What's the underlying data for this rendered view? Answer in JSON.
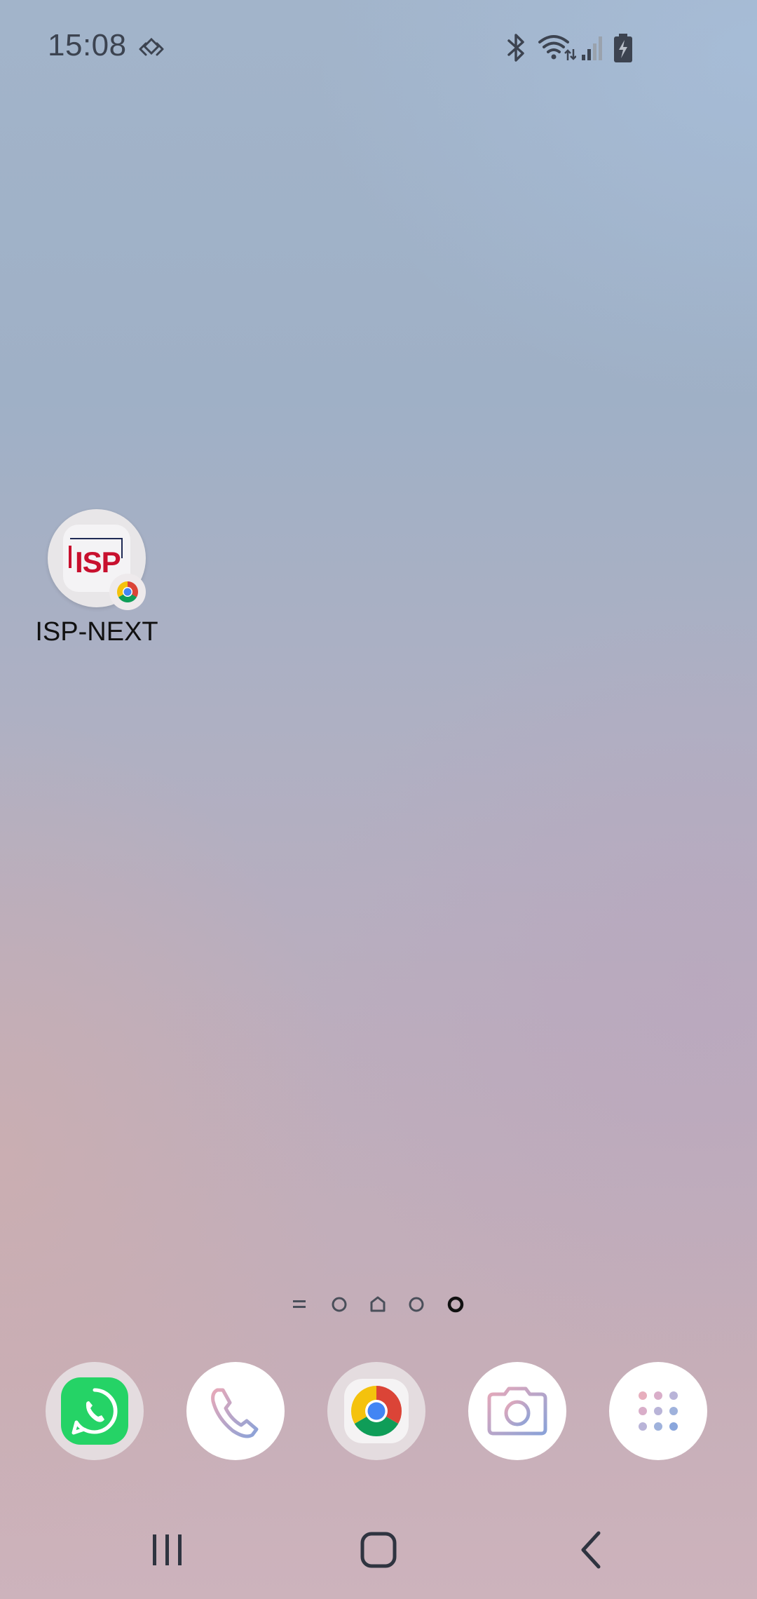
{
  "status_bar": {
    "time": "15:08",
    "icons": [
      "sync-icon",
      "bluetooth-icon",
      "wifi-icon",
      "signal-icon",
      "battery-charging-icon"
    ]
  },
  "home_screen": {
    "apps": [
      {
        "label": "ISP-NEXT",
        "icon": "isp-next-icon",
        "icon_text": "ISP",
        "badge": "chrome-badge-icon"
      }
    ]
  },
  "page_indicators": [
    {
      "icon": "menu-lines-icon",
      "active": false
    },
    {
      "icon": "page-dot-icon",
      "active": false
    },
    {
      "icon": "home-page-icon",
      "active": false
    },
    {
      "icon": "page-dot-icon",
      "active": false
    },
    {
      "icon": "page-dot-icon",
      "active": true
    }
  ],
  "dock": [
    {
      "name": "WhatsApp",
      "icon": "whatsapp-icon"
    },
    {
      "name": "Phone",
      "icon": "phone-icon"
    },
    {
      "name": "Chrome",
      "icon": "chrome-icon"
    },
    {
      "name": "Camera",
      "icon": "camera-icon"
    },
    {
      "name": "Apps",
      "icon": "app-drawer-icon"
    }
  ],
  "nav_bar": [
    "recent-apps-icon",
    "home-icon",
    "back-icon"
  ],
  "colors": {
    "whatsapp_green": "#25d366",
    "chrome_red": "#db4437",
    "chrome_yellow": "#f4c20d",
    "chrome_green": "#0f9d58",
    "chrome_blue": "#4285f4",
    "isp_red": "#c8102e",
    "isp_navy": "#1f2a55"
  }
}
